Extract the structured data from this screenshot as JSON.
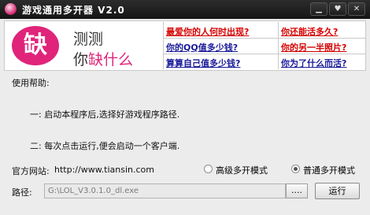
{
  "window": {
    "title": "游戏通用多开器 V2.0",
    "min_label": "▁",
    "max_label": "♥",
    "close_label": "✕"
  },
  "banner": {
    "logo_char": "缺",
    "logo_line1": "测测",
    "logo_line2_pre": "你",
    "logo_line2_accent": "缺什么",
    "accent_color": "#e0247a",
    "links": [
      {
        "text": "最爱你的人何时出现?",
        "color": "red"
      },
      {
        "text": "你还能活多久?",
        "color": "red"
      },
      {
        "text": "你的QQ值多少钱?",
        "color": "blue"
      },
      {
        "text": "你的另一半照片?",
        "color": "red"
      },
      {
        "text": "算算自己值多少钱?",
        "color": "blue"
      },
      {
        "text": "你为了什么而活?",
        "color": "blue"
      }
    ]
  },
  "help": {
    "heading": "使用帮助:",
    "step1": "一: 启动本程序后,选择好游戏程序路径.",
    "step2": "二: 每次点击运行,便会启动一个客户端."
  },
  "site": {
    "label": "官方网站:",
    "url": "http://www.tiansin.com"
  },
  "modes": {
    "advanced_label": "高级多开模式",
    "normal_label": "普通多开模式",
    "selected": "normal"
  },
  "path": {
    "label": "路径:",
    "value": "G:\\LOL_V3.0.1.0_dl.exe",
    "browse_label": "....",
    "run_label": "运行"
  }
}
